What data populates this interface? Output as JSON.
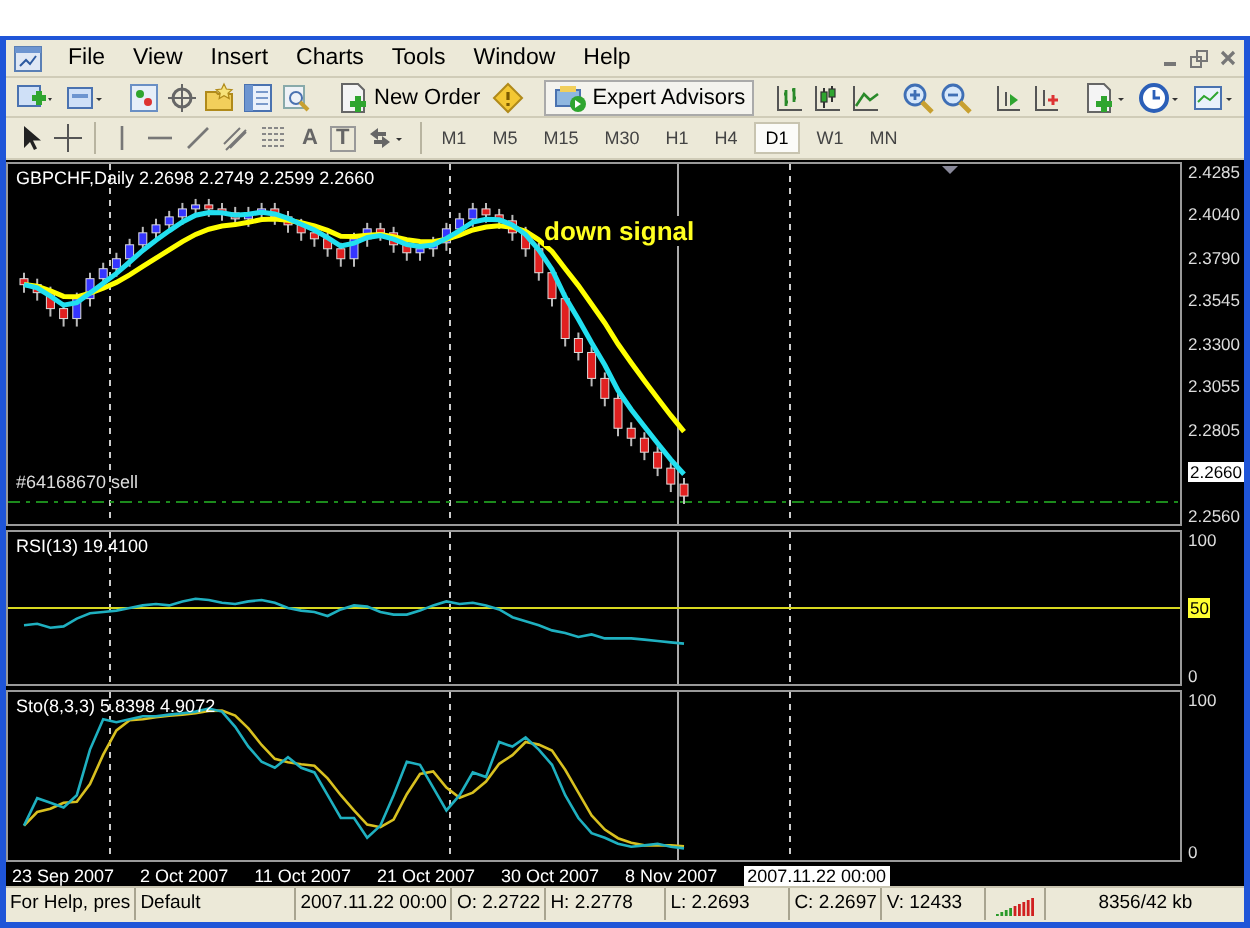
{
  "menu": [
    {
      "label": "File"
    },
    {
      "label": "View"
    },
    {
      "label": "Insert"
    },
    {
      "label": "Charts"
    },
    {
      "label": "Tools"
    },
    {
      "label": "Window"
    },
    {
      "label": "Help"
    }
  ],
  "toolbar": {
    "new_order": "New Order",
    "expert_advisors": "Expert Advisors",
    "text_tool": "A",
    "label_tool": "T"
  },
  "timeframes": [
    {
      "label": "M1",
      "selected": false
    },
    {
      "label": "M5",
      "selected": false
    },
    {
      "label": "M15",
      "selected": false
    },
    {
      "label": "M30",
      "selected": false
    },
    {
      "label": "H1",
      "selected": false
    },
    {
      "label": "H4",
      "selected": false
    },
    {
      "label": "D1",
      "selected": true
    },
    {
      "label": "W1",
      "selected": false
    },
    {
      "label": "MN",
      "selected": false
    }
  ],
  "chart": {
    "title": "GBPCHF,Daily  2.2698 2.2749 2.2599 2.2660",
    "annotation": "down signal",
    "order_label": "#64168670 sell",
    "price_axis": [
      {
        "label": "2.4285",
        "highlighted": false
      },
      {
        "label": "2.4040",
        "highlighted": false
      },
      {
        "label": "2.3790",
        "highlighted": false
      },
      {
        "label": "2.3545",
        "highlighted": false
      },
      {
        "label": "2.3300",
        "highlighted": false
      },
      {
        "label": "2.3055",
        "highlighted": false
      },
      {
        "label": "2.2805",
        "highlighted": false
      },
      {
        "label": "2.2660",
        "highlighted": true
      },
      {
        "label": "2.2560",
        "highlighted": false
      }
    ]
  },
  "rsi": {
    "label": "RSI(13) 19.4100",
    "axis": [
      {
        "label": "100",
        "highlighted": false
      },
      {
        "label": "50",
        "highlighted": true
      },
      {
        "label": "0",
        "highlighted": false
      }
    ]
  },
  "stochastic": {
    "label": "Sto(8,3,3) 5.8398 4.9072",
    "axis": [
      {
        "label": "100",
        "highlighted": false
      },
      {
        "label": "0",
        "highlighted": false
      }
    ]
  },
  "time_axis": [
    "23 Sep 2007",
    "2 Oct 2007",
    "11 Oct 2007",
    "21 Oct 2007",
    "30 Oct 2007",
    "8 Nov 2007"
  ],
  "cursor_time": "2007.11.22 00:00",
  "status_bar": [
    "For Help, pres",
    "Default",
    "2007.11.22 00:00",
    "O: 2.2722",
    "H: 2.2778",
    "L: 2.2693",
    "C: 2.2697",
    "V: 12433",
    "8356/42 kb"
  ]
}
